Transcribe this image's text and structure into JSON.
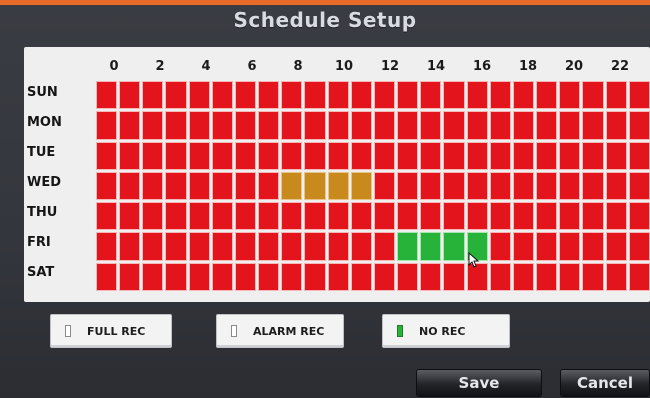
{
  "window": {
    "title": "Schedule Setup"
  },
  "schedule": {
    "hour_labels": [
      "0",
      "2",
      "4",
      "6",
      "8",
      "10",
      "12",
      "14",
      "16",
      "18",
      "20",
      "22"
    ],
    "days": [
      "SUN",
      "MON",
      "TUE",
      "WED",
      "THU",
      "FRI",
      "SAT"
    ],
    "colors": {
      "full_rec": "#e3141c",
      "alarm_rec": "#c88a1c",
      "no_rec": "#27b23a"
    },
    "grid": [
      [
        "F",
        "F",
        "F",
        "F",
        "F",
        "F",
        "F",
        "F",
        "F",
        "F",
        "F",
        "F",
        "F",
        "F",
        "F",
        "F",
        "F",
        "F",
        "F",
        "F",
        "F",
        "F",
        "F",
        "F"
      ],
      [
        "F",
        "F",
        "F",
        "F",
        "F",
        "F",
        "F",
        "F",
        "F",
        "F",
        "F",
        "F",
        "F",
        "F",
        "F",
        "F",
        "F",
        "F",
        "F",
        "F",
        "F",
        "F",
        "F",
        "F"
      ],
      [
        "F",
        "F",
        "F",
        "F",
        "F",
        "F",
        "F",
        "F",
        "F",
        "F",
        "F",
        "F",
        "F",
        "F",
        "F",
        "F",
        "F",
        "F",
        "F",
        "F",
        "F",
        "F",
        "F",
        "F"
      ],
      [
        "F",
        "F",
        "F",
        "F",
        "F",
        "F",
        "F",
        "F",
        "A",
        "A",
        "A",
        "A",
        "F",
        "F",
        "F",
        "F",
        "F",
        "F",
        "F",
        "F",
        "F",
        "F",
        "F",
        "F"
      ],
      [
        "F",
        "F",
        "F",
        "F",
        "F",
        "F",
        "F",
        "F",
        "F",
        "F",
        "F",
        "F",
        "F",
        "F",
        "F",
        "F",
        "F",
        "F",
        "F",
        "F",
        "F",
        "F",
        "F",
        "F"
      ],
      [
        "F",
        "F",
        "F",
        "F",
        "F",
        "F",
        "F",
        "F",
        "F",
        "F",
        "F",
        "F",
        "F",
        "N",
        "N",
        "N",
        "N",
        "F",
        "F",
        "F",
        "F",
        "F",
        "F",
        "F"
      ],
      [
        "F",
        "F",
        "F",
        "F",
        "F",
        "F",
        "F",
        "F",
        "F",
        "F",
        "F",
        "F",
        "F",
        "F",
        "F",
        "F",
        "F",
        "F",
        "F",
        "F",
        "F",
        "F",
        "F",
        "F"
      ]
    ]
  },
  "legend": {
    "full_rec_label": "FULL REC",
    "alarm_rec_label": "ALARM REC",
    "no_rec_label": "NO REC"
  },
  "actions": {
    "save_label": "Save",
    "cancel_label": "Cancel"
  }
}
